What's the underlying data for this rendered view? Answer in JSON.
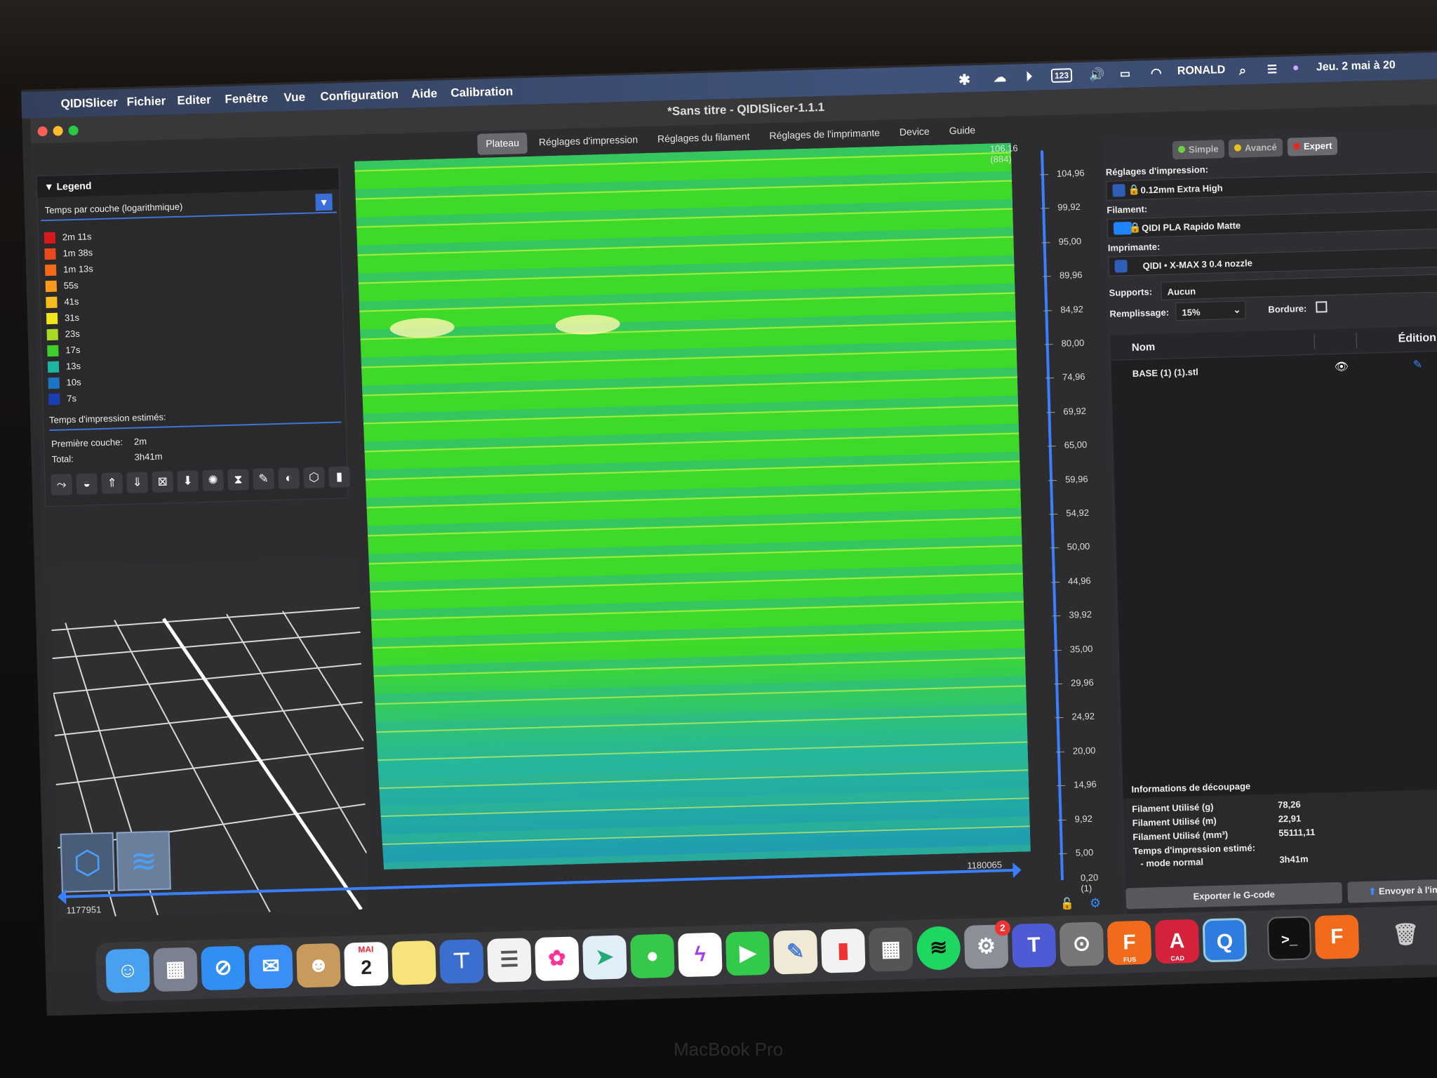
{
  "menubar": {
    "apple_icon": "apple-icon",
    "items": [
      "QIDISlicer",
      "Fichier",
      "Editer",
      "Fenêtre",
      "Vue",
      "Configuration",
      "Aide",
      "Calibration"
    ],
    "status_input": "123",
    "user": "RONALD",
    "datetime": "Jeu. 2 mai à 20"
  },
  "window": {
    "title": "*Sans titre - QIDISlicer-1.1.1",
    "tabs": [
      "Plateau",
      "Réglages d'impression",
      "Réglages du filament",
      "Réglages de l'imprimante",
      "Device",
      "Guide"
    ],
    "active_tab": "Plateau"
  },
  "legend": {
    "header": "Legend",
    "view_type": "Temps par couche (logarithmique)",
    "items": [
      {
        "label": "2m 11s",
        "color": "#d8191b"
      },
      {
        "label": "1m 38s",
        "color": "#e94a1a"
      },
      {
        "label": "1m 13s",
        "color": "#f36b16"
      },
      {
        "label": "55s",
        "color": "#f8991a"
      },
      {
        "label": "41s",
        "color": "#f5bd1d"
      },
      {
        "label": "31s",
        "color": "#f2e51b"
      },
      {
        "label": "23s",
        "color": "#a7d923"
      },
      {
        "label": "17s",
        "color": "#3fcf2b"
      },
      {
        "label": "13s",
        "color": "#1fb3a3"
      },
      {
        "label": "10s",
        "color": "#1a76c4"
      },
      {
        "label": "7s",
        "color": "#1a3fb5"
      }
    ],
    "estimate_title": "Temps d'impression estimés:",
    "first_layer_label": "Première couche:",
    "first_layer_value": "2m",
    "total_label": "Total:",
    "total_value": "3h41m",
    "tools": [
      "travel-icon",
      "wipe-icon",
      "retractions-icon",
      "deretractions-icon",
      "seams-icon",
      "tool-changes-icon",
      "color-changes-icon",
      "pause-icon",
      "custom-gcode-icon",
      "cog-icon",
      "shells-icon",
      "tool-marker-icon"
    ]
  },
  "sliders": {
    "horizontal_left": "1177951",
    "horizontal_right": "1180065",
    "vertical_top_value": "106,16",
    "vertical_top_layer": "(884)",
    "vertical_bottom_value": "0,20",
    "vertical_bottom_layer": "(1)",
    "ticks": [
      "104,96",
      "99,92",
      "95,00",
      "89,96",
      "84,92",
      "80,00",
      "74,96",
      "69,92",
      "65,00",
      "59,96",
      "54,92",
      "50,00",
      "44,96",
      "39,92",
      "35,00",
      "29,96",
      "24,92",
      "20,00",
      "14,96",
      "9,92",
      "5,00"
    ]
  },
  "right_panel": {
    "modes": [
      "Simple",
      "Avancé",
      "Expert"
    ],
    "print_settings_label": "Réglages d'impression:",
    "print_settings_value": "0.12mm Extra High",
    "filament_label": "Filament:",
    "filament_value": "QIDI PLA Rapido Matte",
    "printer_label": "Imprimante:",
    "printer_value": "QIDI • X-MAX 3 0.4 nozzle",
    "supports_label": "Supports:",
    "supports_value": "Aucun",
    "infill_label": "Remplissage:",
    "infill_value": "15%",
    "brim_label": "Bordure:",
    "list_col_name": "Nom",
    "list_col_edit": "Édition",
    "objects": [
      "BASE (1) (1).stl"
    ],
    "slice_info_title": "Informations de découpage",
    "slice_info": [
      {
        "label": "Filament Utilisé (g)",
        "value": "78,26"
      },
      {
        "label": "Filament Utilisé (m)",
        "value": "22,91"
      },
      {
        "label": "Filament Utilisé (mm³)",
        "value": "55111,11"
      }
    ],
    "time_label_1": "Temps d'impression estimé:",
    "time_label_2": "- mode normal",
    "time_value": "3h41m",
    "export_button": "Exporter le G-code",
    "send_button": "Envoyer à l'imprim"
  },
  "dock": {
    "calendar_month": "MAI",
    "calendar_day": "2",
    "badge_count": "2",
    "fusion_label": "FUS",
    "autocad_label": "CAD"
  },
  "bezel": "MacBook Pro"
}
